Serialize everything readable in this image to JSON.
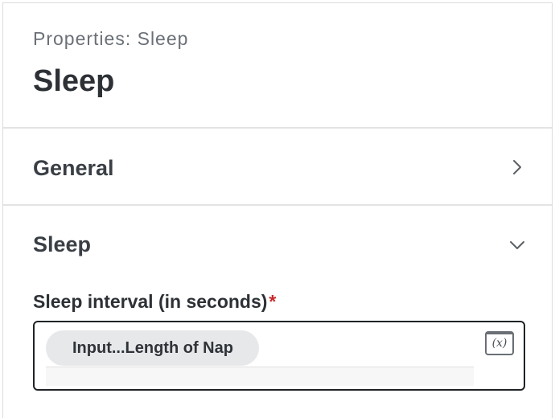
{
  "header": {
    "subtitle": "Properties: Sleep",
    "title": "Sleep"
  },
  "sections": {
    "general": {
      "label": "General",
      "state": "collapsed",
      "icon": "chevron-right-icon"
    },
    "sleep": {
      "label": "Sleep",
      "state": "expanded",
      "icon": "chevron-down-icon"
    }
  },
  "field": {
    "label": "Sleep interval (in seconds)",
    "required_mark": "*",
    "value_chip": "Input...Length of Nap",
    "variable_button": "(x)"
  },
  "colors": {
    "required": "#c62828",
    "chip_bg": "#e6e8ea",
    "text_dark": "#2d3136"
  }
}
